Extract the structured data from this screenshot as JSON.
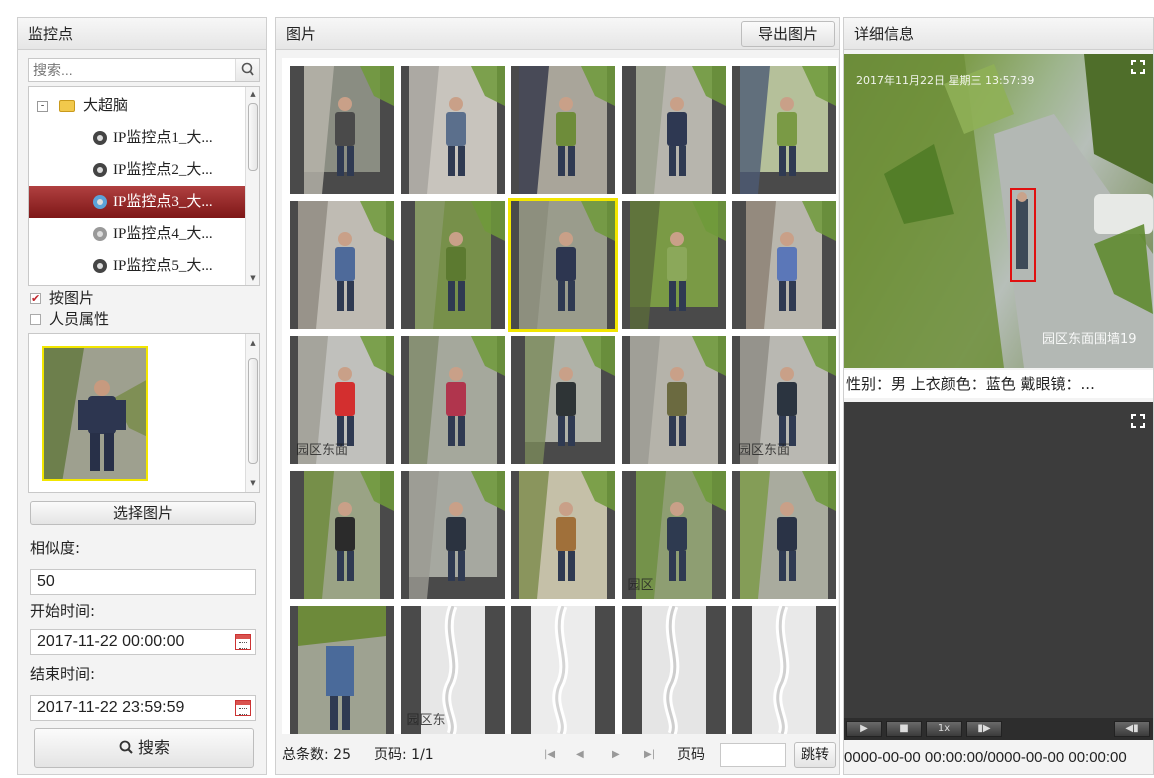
{
  "left_panel": {
    "title": "监控点",
    "search_placeholder": "搜索...",
    "tree": {
      "root_label": "大超脑",
      "items": [
        {
          "label": "IP监控点1_大..."
        },
        {
          "label": "IP监控点2_大..."
        },
        {
          "label": "IP监控点3_大...",
          "selected": true
        },
        {
          "label": "IP监控点4_大..."
        },
        {
          "label": "IP监控点5_大..."
        }
      ]
    },
    "by_image_label": "按图片",
    "by_image_checked": true,
    "person_attr_label": "人员属性",
    "person_attr_checked": false,
    "select_image_button": "选择图片",
    "similarity_label": "相似度:",
    "similarity_value": "50",
    "start_time_label": "开始时间:",
    "start_time_value": "2017-11-22 00:00:00",
    "end_time_label": "结束时间:",
    "end_time_value": "2017-11-22 23:59:59",
    "search_button": "搜索"
  },
  "middle_panel": {
    "title": "图片",
    "export_button": "导出图片",
    "total_label": "总条数: 25",
    "page_info": "页码: 1/1",
    "page_label": "页码",
    "page_input_value": "",
    "jump_button": "跳转",
    "thumbnail_count": 25,
    "selected_index": 7,
    "thumb_overlay_texts": [
      "园区东面",
      "园区东面",
      "园区",
      "园区东"
    ]
  },
  "right_panel": {
    "title": "详细信息",
    "video_timestamp": "2017年11月22日 星期三 13:57:39",
    "video_caption": "园区东面围墙19",
    "detail_text": "性别：男  上衣颜色：蓝色  戴眼镜：...",
    "speed_label": "1x",
    "time_range": "0000-00-00 00:00:00/0000-00-00 00:00:00"
  },
  "colors": {
    "selected_tree": "#8e1f1f",
    "selection_border": "#f2e600",
    "detection_box": "#e01010",
    "checkbox_mark": "#c0262d"
  },
  "icons": [
    "search-icon",
    "folder-icon",
    "camera-icon",
    "calendar-icon",
    "fullscreen-icon",
    "play-icon",
    "stop-icon",
    "step-icon",
    "audio-icon"
  ]
}
